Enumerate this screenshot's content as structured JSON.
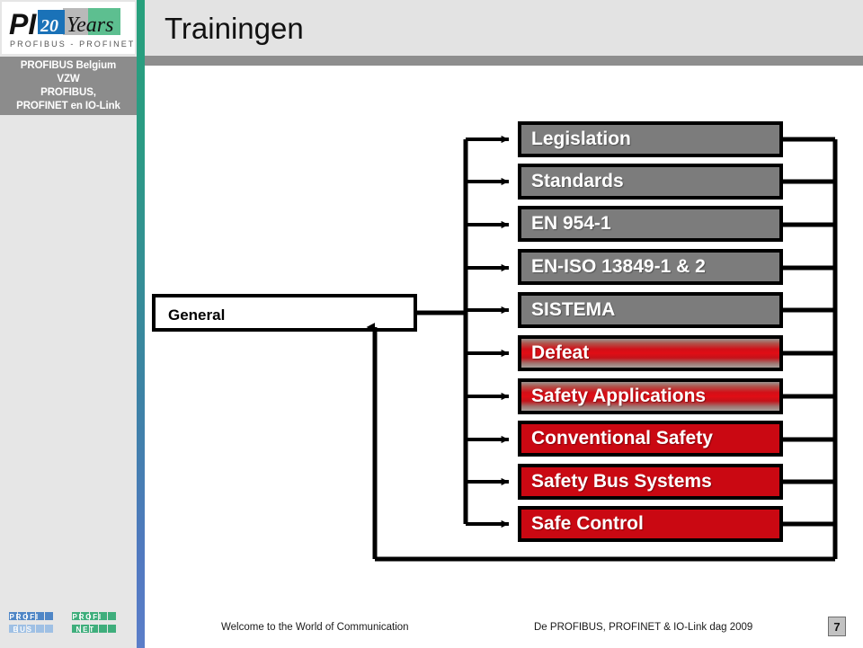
{
  "header": {
    "title": "Trainingen",
    "logo": {
      "name": "pi-20-years-logo",
      "pi_text": "PI",
      "years_number": "20",
      "years_word": "Years",
      "tagline": "PROFIBUS - PROFINET"
    }
  },
  "sidebar": {
    "org_lines": [
      "PROFIBUS Belgium",
      "VZW",
      "PROFIBUS,",
      "PROFINET en IO-Link"
    ]
  },
  "diagram": {
    "root": {
      "label": "General"
    },
    "topics": [
      {
        "label": "Legislation",
        "fill": "gray",
        "color": "#7c7c7c"
      },
      {
        "label": "Standards",
        "fill": "gray",
        "color": "#7c7c7c"
      },
      {
        "label": "EN 954-1",
        "fill": "gray",
        "color": "#7c7c7c"
      },
      {
        "label": "EN-ISO 13849-1 & 2",
        "fill": "gray",
        "color": "#7c7c7c"
      },
      {
        "label": "SISTEMA",
        "fill": "gray",
        "color": "#7c7c7c"
      },
      {
        "label": "Defeat",
        "fill": "gradient",
        "color": "#d21018"
      },
      {
        "label": "Safety Applications",
        "fill": "gradient",
        "color": "#d21018"
      },
      {
        "label": "Conventional Safety",
        "fill": "red",
        "color": "#ca0812"
      },
      {
        "label": "Safety Bus Systems",
        "fill": "red",
        "color": "#ca0812"
      },
      {
        "label": "Safe Control",
        "fill": "red",
        "color": "#ca0812"
      }
    ]
  },
  "footer": {
    "tagline": "Welcome to the World of Communication",
    "event": "De PROFIBUS, PROFINET & IO-Link dag 2009",
    "page_number": "7",
    "logos": [
      {
        "name": "profibus-logo",
        "line1": "PROFI",
        "line2": "BUS"
      },
      {
        "name": "profinet-logo",
        "line1": "PROFI",
        "line2": "NET"
      }
    ]
  },
  "colors": {
    "stripe_top": "#27a07c",
    "stripe_bottom": "#5b7ec9",
    "sidebar_bg": "#e6e6e6",
    "org_bg": "#8c8c8c",
    "title_bg": "#e3e3e3",
    "title_underbar": "#8e8e8e"
  }
}
